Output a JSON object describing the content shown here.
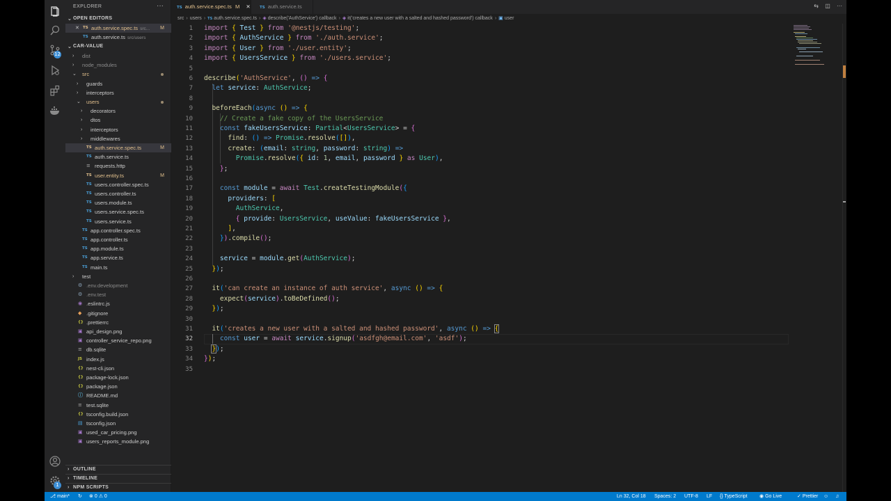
{
  "explorer": {
    "header": "EXPLORER",
    "more": "···",
    "open_editors_label": "OPEN EDITORS",
    "open_editors": [
      {
        "name": "auth.service.spec.ts",
        "desc": "src...",
        "status": "M",
        "ext": "TS"
      },
      {
        "name": "auth.service.ts",
        "desc": "src/users",
        "status": "",
        "ext": "TS"
      }
    ],
    "project_label": "CAR-VALUE",
    "tree": [
      {
        "name": "dist",
        "kind": "folder",
        "depth": 0
      },
      {
        "name": "node_modules",
        "kind": "folder",
        "depth": 0
      },
      {
        "name": "src",
        "kind": "folder-open",
        "depth": 0
      },
      {
        "name": "guards",
        "kind": "folder",
        "depth": 1
      },
      {
        "name": "interceptors",
        "kind": "folder",
        "depth": 1
      },
      {
        "name": "users",
        "kind": "folder-open",
        "depth": 1
      },
      {
        "name": "decorators",
        "kind": "folder",
        "depth": 2
      },
      {
        "name": "dtos",
        "kind": "folder",
        "depth": 2
      },
      {
        "name": "interceptors",
        "kind": "folder",
        "depth": 2
      },
      {
        "name": "middlewares",
        "kind": "folder",
        "depth": 2
      },
      {
        "name": "auth.service.spec.ts",
        "kind": "ts-mod",
        "depth": 2,
        "status": "M"
      },
      {
        "name": "auth.service.ts",
        "kind": "ts",
        "depth": 2
      },
      {
        "name": "requests.http",
        "kind": "http",
        "depth": 2
      },
      {
        "name": "user.entity.ts",
        "kind": "ts-mod",
        "depth": 2,
        "status": "M"
      },
      {
        "name": "users.controller.spec.ts",
        "kind": "ts",
        "depth": 2
      },
      {
        "name": "users.controller.ts",
        "kind": "ts",
        "depth": 2
      },
      {
        "name": "users.module.ts",
        "kind": "ts",
        "depth": 2
      },
      {
        "name": "users.service.spec.ts",
        "kind": "ts",
        "depth": 2
      },
      {
        "name": "users.service.ts",
        "kind": "ts",
        "depth": 2
      },
      {
        "name": "app.controller.spec.ts",
        "kind": "ts",
        "depth": 1
      },
      {
        "name": "app.controller.ts",
        "kind": "ts",
        "depth": 1
      },
      {
        "name": "app.module.ts",
        "kind": "ts",
        "depth": 1
      },
      {
        "name": "app.service.ts",
        "kind": "ts",
        "depth": 1
      },
      {
        "name": "main.ts",
        "kind": "ts",
        "depth": 1
      },
      {
        "name": "test",
        "kind": "folder",
        "depth": 0
      },
      {
        "name": ".env.development",
        "kind": "env",
        "depth": 0
      },
      {
        "name": ".env.test",
        "kind": "env",
        "depth": 0
      },
      {
        "name": ".eslintrc.js",
        "kind": "eslint",
        "depth": 0
      },
      {
        "name": ".gitignore",
        "kind": "git",
        "depth": 0
      },
      {
        "name": ".prettierrc",
        "kind": "json",
        "depth": 0
      },
      {
        "name": "api_design.png",
        "kind": "img",
        "depth": 0
      },
      {
        "name": "controller_service_repo.png",
        "kind": "img",
        "depth": 0
      },
      {
        "name": "db.sqlite",
        "kind": "db",
        "depth": 0
      },
      {
        "name": "index.js",
        "kind": "js",
        "depth": 0
      },
      {
        "name": "nest-cli.json",
        "kind": "json",
        "depth": 0
      },
      {
        "name": "package-lock.json",
        "kind": "json",
        "depth": 0
      },
      {
        "name": "package.json",
        "kind": "json",
        "depth": 0
      },
      {
        "name": "README.md",
        "kind": "md",
        "depth": 0
      },
      {
        "name": "test.sqlite",
        "kind": "db",
        "depth": 0
      },
      {
        "name": "tsconfig.build.json",
        "kind": "json",
        "depth": 0
      },
      {
        "name": "tsconfig.json",
        "kind": "tsconfig",
        "depth": 0
      },
      {
        "name": "used_car_pricing.png",
        "kind": "img",
        "depth": 0
      },
      {
        "name": "users_reports_module.png",
        "kind": "img",
        "depth": 0
      }
    ],
    "bottom_sections": [
      "OUTLINE",
      "TIMELINE",
      "NPM SCRIPTS"
    ]
  },
  "activity_bar": {
    "icons": [
      "files-icon",
      "search-icon",
      "source-control-icon",
      "run-debug-icon",
      "extensions-icon",
      "docker-icon"
    ],
    "scm_badge": "12",
    "bottom_icons": [
      "account-icon",
      "settings-gear-icon"
    ],
    "settings_badge": "1"
  },
  "tabs": [
    {
      "ext": "TS",
      "label": "auth.service.spec.ts",
      "status": "M",
      "active": true
    },
    {
      "ext": "TS",
      "label": "auth.service.ts",
      "status": "",
      "active": false
    }
  ],
  "breadcrumb": [
    "src",
    "users",
    "auth.service.spec.ts",
    "describe('AuthService') callback",
    "it('creates a new user with a salted and hashed password') callback",
    "user"
  ],
  "editor": {
    "line_count": 35,
    "current_line": 32
  },
  "status_bar": {
    "branch": "main*",
    "problems": "0",
    "warnings": "0",
    "position": "Ln 32, Col 18",
    "spaces": "Spaces: 2",
    "encoding": "UTF-8",
    "eol": "LF",
    "language": "TypeScript",
    "go_live": "Go Live",
    "prettier": "Prettier"
  },
  "colors": {
    "accent": "#007acc",
    "modified": "#e2c08d",
    "editor_bg": "#1e1e1e",
    "sidebar_bg": "#252526"
  }
}
